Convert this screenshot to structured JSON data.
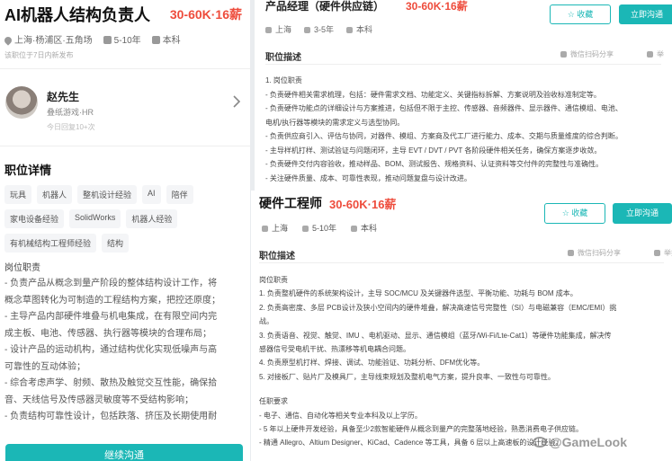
{
  "left_card": {
    "title": "AI机器人结构负责人",
    "salary": "30-60K·16薪",
    "location": "上海·杨浦区·五角场",
    "experience": "5-10年",
    "education": "本科",
    "updated": "该职位于7日内新发布",
    "recruiter": {
      "name": "赵先生",
      "company": "叠纸游戏·HR",
      "reply": "今日回复10+次"
    },
    "section_title": "职位详情",
    "tags": [
      "玩具",
      "机器人",
      "整机设计经验",
      "AI",
      "陪伴",
      "家电设备经验",
      "SolidWorks",
      "机器人经验",
      "有机械结构工程师经验",
      "结构"
    ],
    "duty_title": "岗位职责",
    "duties": [
      "- 负责产品从概念到量产阶段的整体结构设计工作，将",
      "概念草图转化为可制造的工程结构方案，把控还原度；",
      "- 主导产品内部硬件堆叠与机电集成，在有限空间内完",
      "成主板、电池、传感器、执行器等模块的合理布局；",
      "- 设计产品的运动机构，通过结构优化实现低噪声与高",
      "可靠性的互动体验；",
      "- 综合考虑声学、射频、散热及触觉交互性能，确保拾",
      "音、天线信号及传感器灵敏度等不受结构影响；",
      "- 负责结构可靠性设计，包括跌落、挤压及长期使用耐"
    ],
    "cta": "继续沟通"
  },
  "top_card": {
    "title": "产品经理（硬件供应链）",
    "salary": "30-60K·16薪",
    "fav_label": "☆ 收藏",
    "chat_label": "立即沟通",
    "location": "上海",
    "experience": "3-5年",
    "education": "本科",
    "desc_title": "职位描述",
    "share": "微信扫码分享",
    "report": "举",
    "lines": [
      "1. 岗位职责",
      "- 负责硬件相关需求梳理，包括：硬件需求文档、功能定义、关键指标拆解、方案说明及验收标准制定等。",
      "- 负责硬件功能点的详细设计与方案推进，包括但不限于主控、传感器、音频器件、显示器件、通信模组、电池、",
      "电机/执行器等模块的需求定义与选型协同。",
      "- 负责供应商引入、评估与协同，对器件、模组、方案商及代工厂进行能力、成本、交期与质量维度的综合判断。",
      "- 主导样机打样、测试验证与问题闭环，主导 EVT / DVT / PVT 各阶段硬件相关任务，确保方案逐步收敛。",
      "- 负责硬件交付内容验收，推动样品、BOM、测试报告、规格资料、认证资料等交付件的完整性与准确性。",
      "- 关注硬件质量、成本、可靠性表现，推动问题复盘与设计改进。"
    ]
  },
  "bottom_card": {
    "title": "硬件工程师",
    "salary": "30-60K·16薪",
    "fav_label": "☆ 收藏",
    "chat_label": "立即沟通",
    "location": "上海",
    "experience": "5-10年",
    "education": "本科",
    "desc_title": "职位描述",
    "share": "微信扫码分享",
    "report": "举报",
    "duty_title": "岗位职责",
    "duties": [
      "1. 负责整机硬件的系统架构设计，主导 SOC/MCU 及关键器件选型、平衡功能、功耗与 BOM 成本。",
      "2. 负责高密度、多层 PCB设计及狭小空间内的硬件堆叠，解决高速信号完整性（SI）与电磁兼容（EMC/EMI）挑",
      "战。",
      "3. 负责语音、视觉、触觉、IMU 、电机驱动、显示、通信模组（蓝牙/Wi-Fi/Lte-Cat1）等硬件功能集成，解决传",
      "感器信号受电机干扰、热漂移等机电耦合问题。",
      "4. 负责原型机打样、焊接、调试、功能验证、功耗分析、DFM优化等。",
      "5. 对接板厂、贴片厂及模具厂，主导线束规划及整机电气方案，提升良率、一致性与可靠性。"
    ],
    "req_title": "任职要求",
    "reqs": [
      "- 电子、通信、自动化等相关专业本科及以上学历。",
      "- 5 年以上硬件开发经验，具备至少2款智能硬件从概念到量产的完整落地经验，熟悉消费电子供应链。",
      "- 精通 Allegro、Altium Designer、KiCad、Cadence 等工具，具备 6 层以上高速板的设计经验。"
    ]
  },
  "watermark": "@GameLook"
}
